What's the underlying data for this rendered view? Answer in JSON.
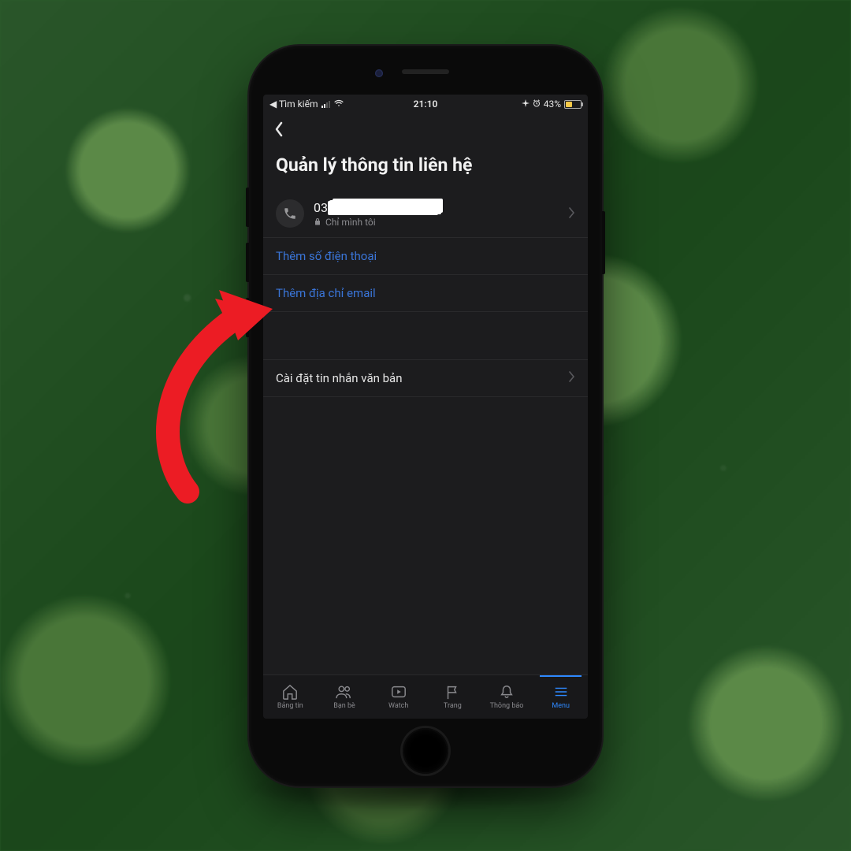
{
  "status": {
    "back_app": "◀ Tìm kiếm",
    "time": "21:10",
    "battery_pct": "43%"
  },
  "header": {
    "title": "Quản lý thông tin liên hệ"
  },
  "contact": {
    "phone_prefix": "03",
    "privacy_label": "Chỉ mình tôi"
  },
  "actions": {
    "add_phone": "Thêm số điện thoại",
    "add_email": "Thêm địa chỉ email"
  },
  "settings": {
    "sms_settings": "Cài đặt tin nhắn văn bản"
  },
  "tabs": [
    {
      "label": "Bảng tin"
    },
    {
      "label": "Bạn bè"
    },
    {
      "label": "Watch"
    },
    {
      "label": "Trang"
    },
    {
      "label": "Thông báo"
    },
    {
      "label": "Menu"
    }
  ],
  "callout": {
    "meaning": "red-arrow-pointing-to-add-phone"
  }
}
